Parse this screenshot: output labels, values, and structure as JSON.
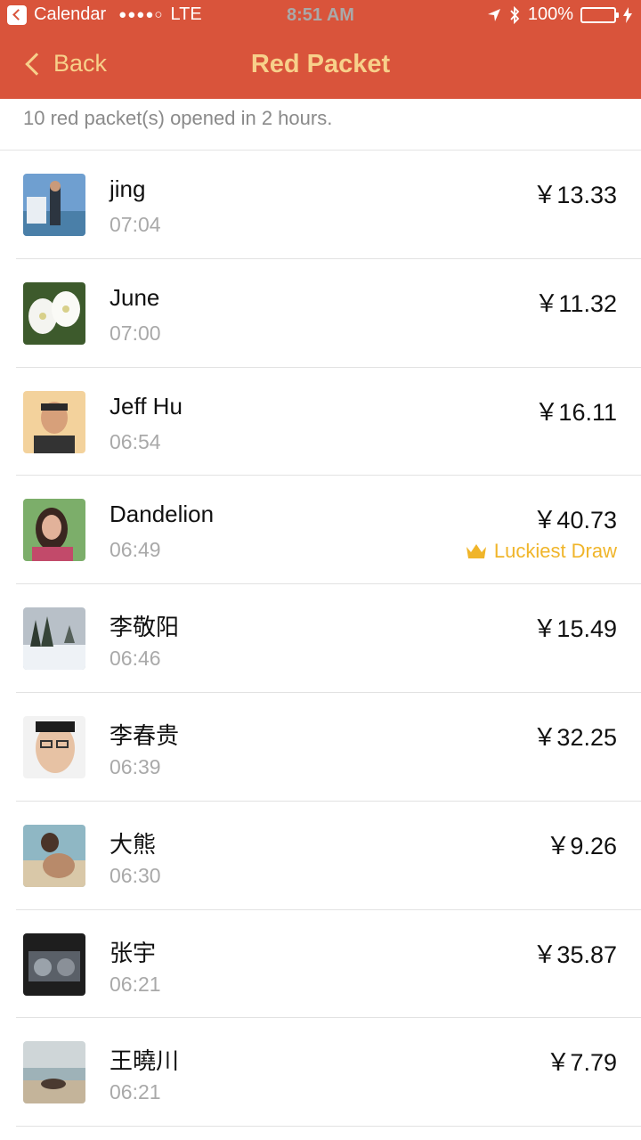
{
  "status_bar": {
    "back_app": "Calendar",
    "signal": "●●●●○",
    "carrier": "LTE",
    "time": "8:51 AM",
    "battery": "100%"
  },
  "nav": {
    "back_label": "Back",
    "title": "Red Packet"
  },
  "summary": "10 red packet(s) opened in 2 hours.",
  "colors": {
    "header": "#d9543b",
    "nav_text": "#f7d08a",
    "luckiest": "#f0b52a"
  },
  "rows": [
    {
      "name": "jing",
      "time": "07:04",
      "amount": "￥13.33",
      "avatar_icon": "person-by-water-avatar"
    },
    {
      "name": "June",
      "time": "07:00",
      "amount": "￥11.32",
      "avatar_icon": "white-flowers-avatar"
    },
    {
      "name": "Jeff Hu",
      "time": "06:54",
      "amount": "￥16.11",
      "avatar_icon": "man-portrait-avatar"
    },
    {
      "name": "Dandelion",
      "time": "06:49",
      "amount": "￥40.73",
      "avatar_icon": "woman-portrait-avatar",
      "badge": "Luckiest Draw"
    },
    {
      "name": "李敬阳",
      "time": "06:46",
      "amount": "￥15.49",
      "avatar_icon": "snowy-trees-avatar"
    },
    {
      "name": "李春贵",
      "time": "06:39",
      "amount": "￥32.25",
      "avatar_icon": "man-glasses-avatar"
    },
    {
      "name": "大熊",
      "time": "06:30",
      "amount": "￥9.26",
      "avatar_icon": "beach-woman-avatar"
    },
    {
      "name": "张宇",
      "time": "06:21",
      "amount": "￥35.87",
      "avatar_icon": "dark-scene-avatar"
    },
    {
      "name": "王曉川",
      "time": "06:21",
      "amount": "￥7.79",
      "avatar_icon": "beach-rocks-avatar"
    }
  ]
}
